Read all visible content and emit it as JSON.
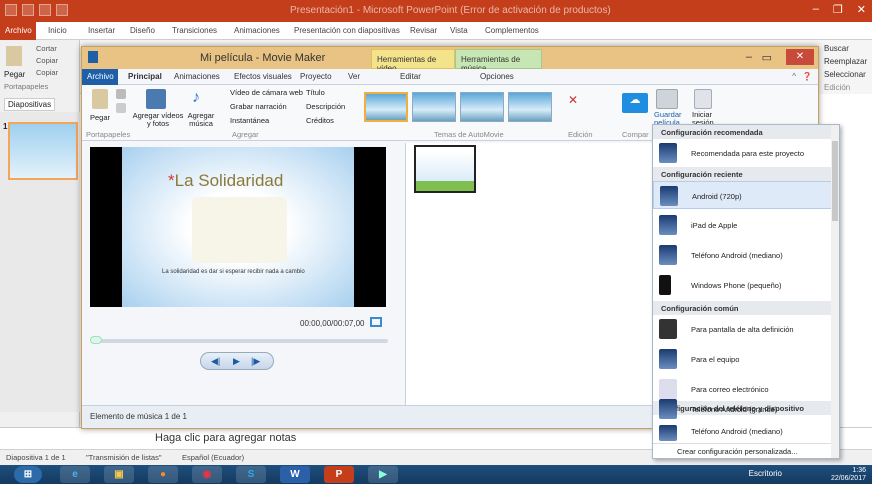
{
  "powerpoint": {
    "title": "Presentación1 - Microsoft PowerPoint (Error de activación de productos)",
    "file_tab": "Archivo",
    "tabs": [
      "Inicio",
      "Insertar",
      "Diseño",
      "Transiciones",
      "Animaciones",
      "Presentación con diapositivas",
      "Revisar",
      "Vista",
      "Complementos"
    ],
    "clipboard": {
      "paste": "Pegar",
      "cut": "Cortar",
      "copy": "Copiar",
      "copy_format": "Copiar",
      "group": "Portapapeles"
    },
    "right_ribbon": [
      "Buscar",
      "Reemplazar",
      "Seleccionar",
      "Edición"
    ],
    "slides_tab": "Diapositivas",
    "slide_number": "1",
    "notes_placeholder": "Haga clic para agregar notas",
    "status": {
      "slide": "Diapositiva 1 de 1",
      "theme": "\"Transmisión de listas\"",
      "language": "Español (Ecuador)"
    }
  },
  "moviemaker": {
    "title": "Mi película - Movie Maker",
    "context_tabs": {
      "video": "Herramientas de vídeo",
      "music": "Herramientas de música",
      "edit": "Editar",
      "options": "Opciones"
    },
    "file_tab": "Archivo",
    "tabs": [
      "Principal",
      "Animaciones",
      "Efectos visuales",
      "Proyecto",
      "Ver"
    ],
    "ribbon": {
      "paste": "Pegar",
      "add_videos": "Agregar vídeos y fotos",
      "add_music": "Agregar música",
      "webcam": "Vídeo de cámara web",
      "narration": "Grabar narración",
      "snapshot": "Instantánea",
      "title": "Título",
      "caption": "Descripción",
      "credits": "Créditos",
      "save_movie": "Guardar película",
      "sign_in": "Iniciar sesión",
      "groups": {
        "clipboard": "Portapapeles",
        "add": "Agregar",
        "automovie": "Temas de AutoMovie",
        "edit": "Edición",
        "share": "Compar"
      }
    },
    "preview": {
      "slide_title_mark": "*",
      "slide_title": "La Solidaridad",
      "slide_body": "La solidaridad es dar si esperar recibir nada a cambio",
      "time": "00:00,00/00:07,00"
    },
    "status": "Elemento de música 1 de 1"
  },
  "dropdown": {
    "sections": [
      {
        "header": "Configuración recomendada",
        "items": [
          "Recomendada para este proyecto"
        ]
      },
      {
        "header": "Configuración reciente",
        "items": [
          "Android (720p)",
          "iPad de Apple",
          "Teléfono Android (mediano)",
          "Windows Phone (pequeño)"
        ]
      },
      {
        "header": "Configuración común",
        "items": [
          "Para pantalla de alta definición",
          "Para el equipo",
          "Para correo electrónico"
        ]
      },
      {
        "header": "Configuración del teléfono y dispositivo",
        "items": [
          "Teléfono Android (grande)",
          "Teléfono Android (mediano)"
        ]
      }
    ],
    "custom": "Crear configuración personalizada..."
  },
  "taskbar": {
    "desktop": "Escritorio",
    "time": "1:36",
    "date": "22/06/2017"
  },
  "colors": {
    "ppt_accent": "#c43e1c",
    "mm_title": "#e9c383",
    "mm_file": "#1f5fa8"
  }
}
